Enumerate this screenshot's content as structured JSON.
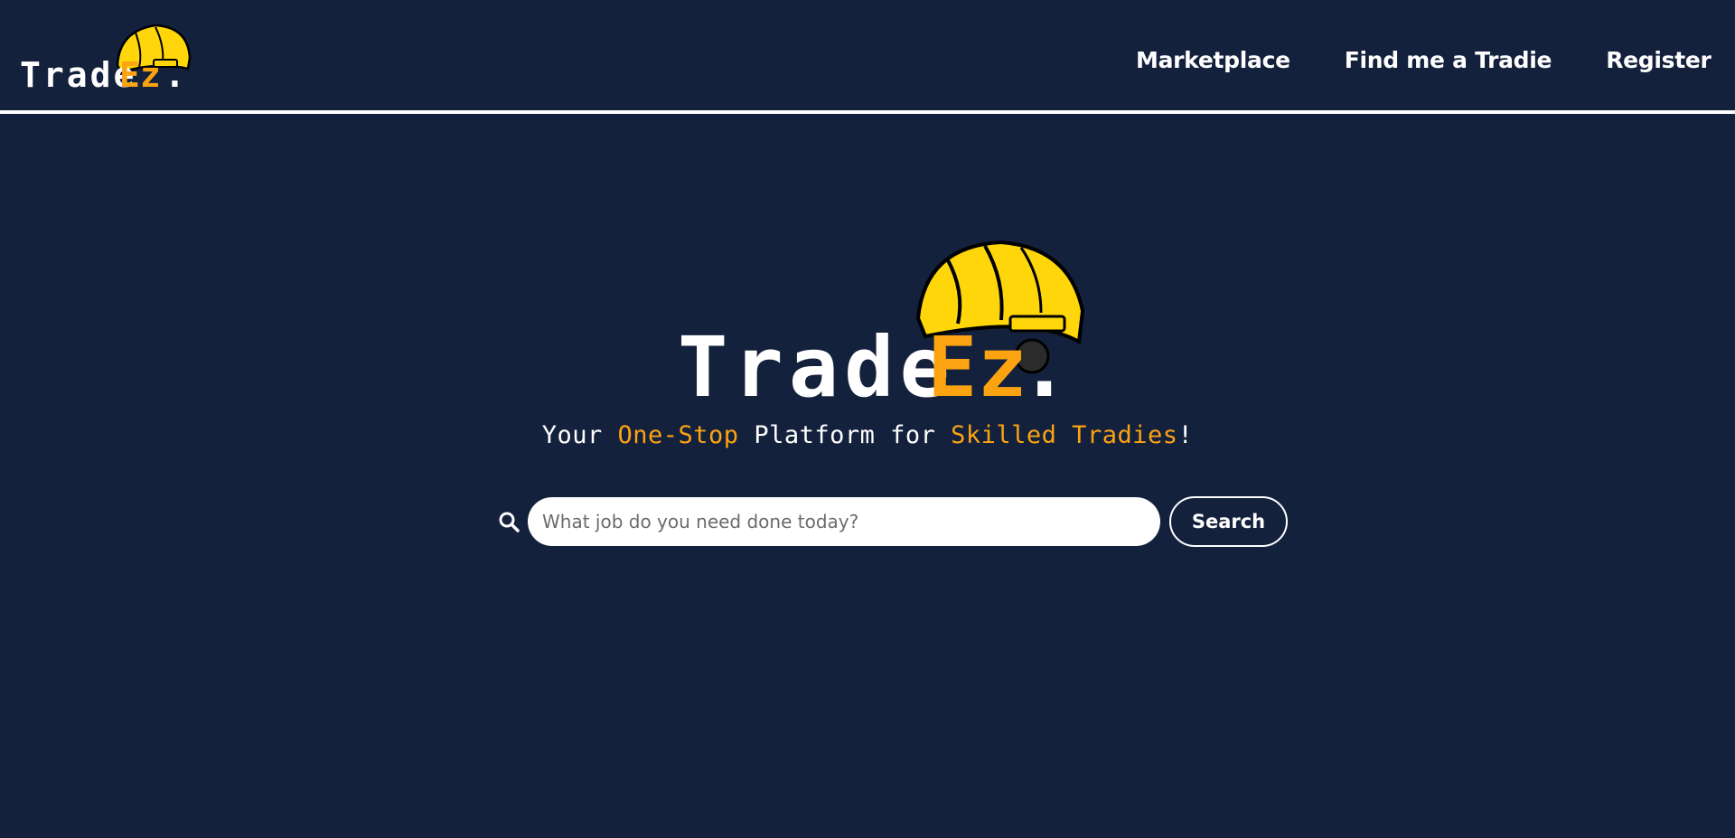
{
  "brand": {
    "name_main": "Trade",
    "name_accent": "Ez",
    "name_dot": ".",
    "colors": {
      "background": "#14213d",
      "accent": "#fca311",
      "helmet": "#ffd60a",
      "text": "#ffffff"
    }
  },
  "nav": {
    "items": [
      {
        "label": "Marketplace"
      },
      {
        "label": "Find me a Tradie"
      },
      {
        "label": "Register"
      }
    ]
  },
  "hero": {
    "tagline": {
      "part1": "Your ",
      "accent1": "One-Stop",
      "part2": " Platform for ",
      "accent2": "Skilled Tradies",
      "part3": "!"
    }
  },
  "search": {
    "placeholder": "What job do you need done today?",
    "value": "",
    "button_label": "Search",
    "icon": "magnifier-icon"
  }
}
